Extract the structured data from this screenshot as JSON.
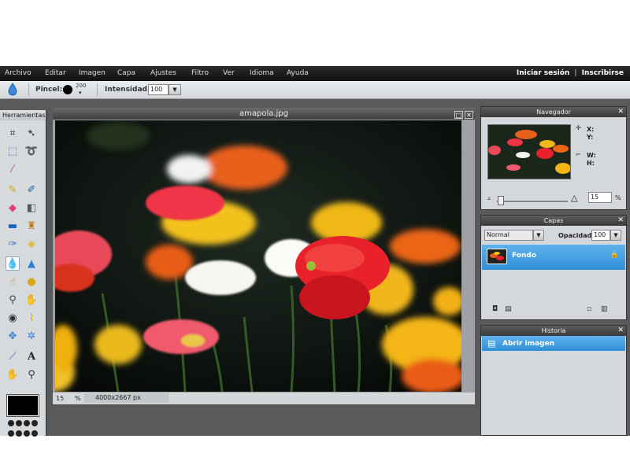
{
  "menu": {
    "items": [
      "Archivo",
      "Editar",
      "Imagen",
      "Capa",
      "Ajustes",
      "Filtro",
      "Ver",
      "Idioma",
      "Ayuda"
    ],
    "login": "Iniciar sesión",
    "separator": "|",
    "signup": "Inscribirse"
  },
  "options": {
    "brush_label": "Pincel:",
    "brush_size": "200",
    "brush_caret": "▾",
    "intensity_label": "Intensidad:",
    "intensity_value": "100",
    "dropdown_arrow": "▼"
  },
  "tools_panel": {
    "title": "Herramientas"
  },
  "image_window": {
    "title": "amapola.jpg",
    "zoom": "15",
    "zoom_unit": "%",
    "dimensions": "4000x2667 px"
  },
  "navigator": {
    "title": "Navegador",
    "x_label": "X:",
    "y_label": "Y:",
    "w_label": "W:",
    "h_label": "H:",
    "zoom": "15",
    "zoom_unit": "%"
  },
  "layers": {
    "title": "Capas",
    "blend_mode": "Normal",
    "opacity_label": "Opacidad:",
    "opacity_value": "100",
    "layer_name": "Fondo"
  },
  "history": {
    "title": "Historia",
    "entry": "Abrir imagen"
  },
  "icons": {
    "close": "✕",
    "maximize": "□",
    "lock": "🔒"
  }
}
